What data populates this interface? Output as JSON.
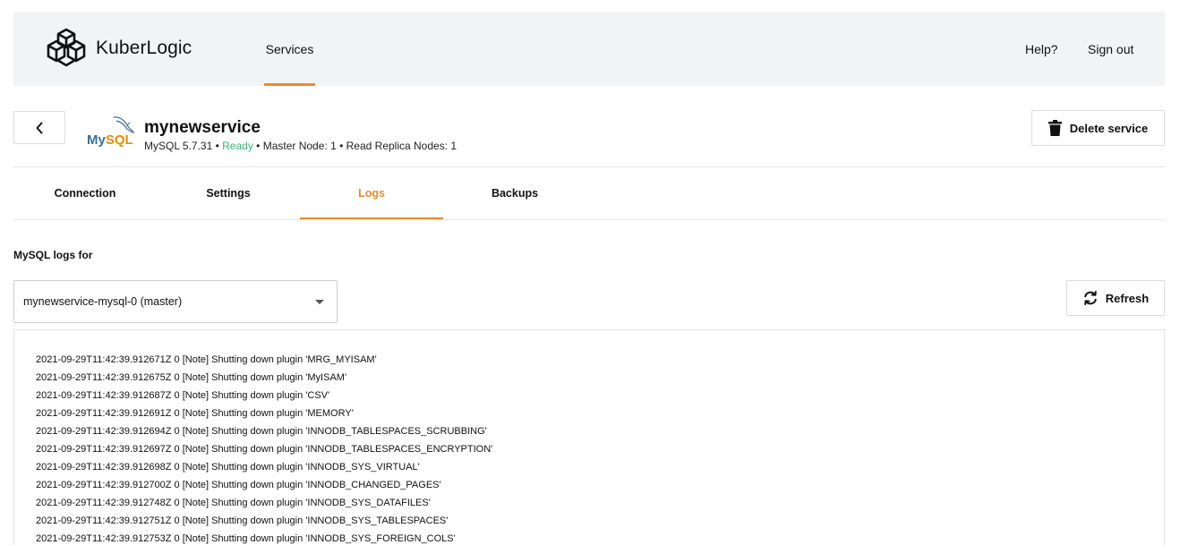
{
  "header": {
    "brand": "KuberLogic",
    "nav": {
      "services": "Services"
    },
    "help": "Help?",
    "sign_out": "Sign out"
  },
  "service": {
    "name": "mynewservice",
    "engine_logo_text": "MySQL",
    "version": "MySQL 5.7.31",
    "separator": " • ",
    "status": "Ready",
    "master_nodes": "Master Node: 1",
    "replica_nodes": "Read Replica Nodes: 1",
    "delete_label": "Delete service"
  },
  "colors": {
    "accent": "#e98a2d",
    "ready": "#3cb371",
    "topbar_bg": "#f2f3f5"
  },
  "tabs": [
    {
      "label": "Connection",
      "active": false
    },
    {
      "label": "Settings",
      "active": false
    },
    {
      "label": "Logs",
      "active": true
    },
    {
      "label": "Backups",
      "active": false
    }
  ],
  "logs": {
    "label": "MySQL logs for",
    "selected_instance": "mynewservice-mysql-0 (master)",
    "refresh_label": "Refresh",
    "lines": [
      "2021-09-29T11:42:39.912671Z 0 [Note] Shutting down plugin 'MRG_MYISAM'",
      "2021-09-29T11:42:39.912675Z 0 [Note] Shutting down plugin 'MyISAM'",
      "2021-09-29T11:42:39.912687Z 0 [Note] Shutting down plugin 'CSV'",
      "2021-09-29T11:42:39.912691Z 0 [Note] Shutting down plugin 'MEMORY'",
      "2021-09-29T11:42:39.912694Z 0 [Note] Shutting down plugin 'INNODB_TABLESPACES_SCRUBBING'",
      "2021-09-29T11:42:39.912697Z 0 [Note] Shutting down plugin 'INNODB_TABLESPACES_ENCRYPTION'",
      "2021-09-29T11:42:39.912698Z 0 [Note] Shutting down plugin 'INNODB_SYS_VIRTUAL'",
      "2021-09-29T11:42:39.912700Z 0 [Note] Shutting down plugin 'INNODB_CHANGED_PAGES'",
      "2021-09-29T11:42:39.912748Z 0 [Note] Shutting down plugin 'INNODB_SYS_DATAFILES'",
      "2021-09-29T11:42:39.912751Z 0 [Note] Shutting down plugin 'INNODB_SYS_TABLESPACES'",
      "2021-09-29T11:42:39.912753Z 0 [Note] Shutting down plugin 'INNODB_SYS_FOREIGN_COLS'"
    ]
  }
}
